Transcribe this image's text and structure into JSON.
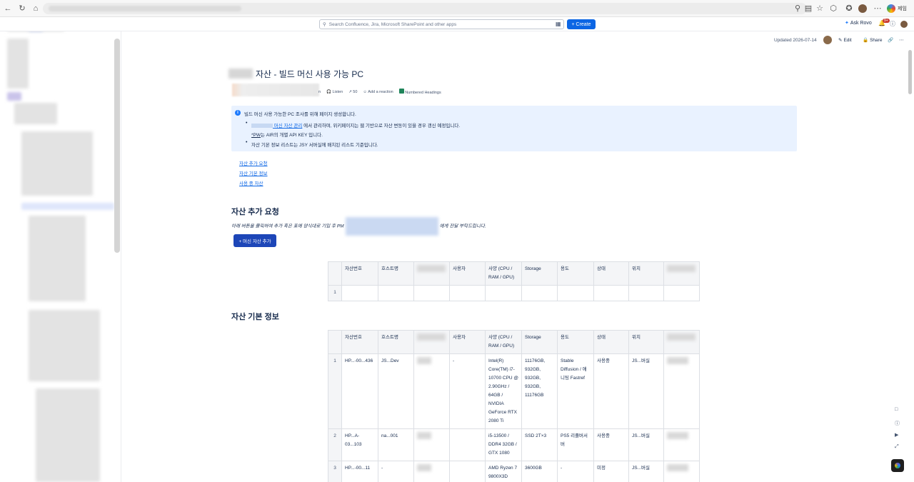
{
  "browser": {
    "back_icon": "back-arrow-icon",
    "reload_icon": "reload-icon",
    "home_icon": "home-icon",
    "profile_label": "제임"
  },
  "topnav": {
    "search_placeholder": "Search Confluence, Jira, Microsoft SharePoint and other apps",
    "create_label": "Create",
    "ask_rovo_label": "Ask Rovo",
    "notification_count": "9+"
  },
  "page_header": {
    "updated": "Updated 2026-07-14",
    "edit_label": "Edit",
    "share_label": "Share"
  },
  "page": {
    "title": "자산 - 빌드 머신 사용 가능 PC",
    "byline": {
      "suffix": "n",
      "listen": "Listen",
      "views": "50",
      "reaction": "Add a reaction",
      "numbered_headings": "Numbered Headings"
    },
    "info": {
      "line1": "빌드 머신 사용 가능한 PC 조사를 위해 페이지 생성합니다.",
      "bullet1_link": "머신 자산 관리",
      "bullet1_rest": "에서 관리하며, 위키페이지는 웹 기반으로 자산 변동이 있을 경우 갱신 예정입니다.",
      "bullet1_line2_pw": "*PW",
      "bullet1_line2_rest": "는 AIR의 개별 API KEY 입니다.",
      "bullet2": "자산 기본 정보 리스트는 JSY 서버실에 배치된 리스트 기준입니다."
    },
    "toc": [
      "자산 추가 요청",
      "자산 기본 정보",
      "사용 중 자산"
    ],
    "section1": {
      "heading": "자산 추가 요청",
      "desc_before": "아래 버튼을 클릭하여 추가 혹은 표에 양식대로 기입 후 PM",
      "desc_after": "에게 전달 부탁드립니다.",
      "button_label": "+ 머신 자산 추가"
    },
    "section2": {
      "heading": "자산 기본 정보"
    },
    "table_headers": [
      "자산번호",
      "호스트명",
      "",
      "사용자",
      "사양 (CPU / RAM / GPU)",
      "Storage",
      "용도",
      "상태",
      "위치",
      ""
    ],
    "request_table": {
      "rows": [
        {
          "num": "1"
        }
      ]
    },
    "asset_table": {
      "rows": [
        {
          "num": "1",
          "asset_no": "HP...-00...436",
          "host": "JS...Dev",
          "user": "-",
          "spec": "Intel(R) Core(TM) i7-10700 CPU @ 2.90GHz / 64GB / NVIDIA GeForce RTX 2080 Ti",
          "storage": "11176GB, 932GB, 932GB, 932GB, 11176GB",
          "purpose": "Stable Diffusion / 애니팅 Fastref",
          "status": "사용중",
          "location": "JS...버실"
        },
        {
          "num": "2",
          "asset_no": "HP...A-03...103",
          "host": "na...001",
          "user": "",
          "spec": "i5-13500 / DDR4 32GB / GTX 1080",
          "storage": "SSD 2T×3",
          "purpose": "PS5 리졸버서버",
          "status": "사용중",
          "location": "JS...버실"
        },
        {
          "num": "3",
          "asset_no": "HP...-00...11",
          "host": "-",
          "user": "",
          "spec": "AMD Ryzen 7 9800X3D",
          "storage": "3600GB",
          "purpose": "-",
          "status": "미정",
          "location": "JS...버실"
        }
      ]
    }
  },
  "colors": {
    "accent": "#0c66e4",
    "info_panel": "#e9f2ff",
    "button": "#1d46b8"
  }
}
